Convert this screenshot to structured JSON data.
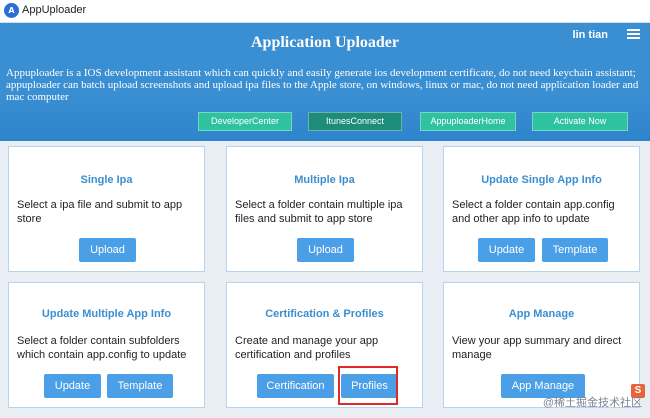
{
  "window": {
    "title": "AppUploader",
    "icon": "app-logo-icon"
  },
  "header": {
    "user": "lin tian",
    "title": "Application Uploader",
    "description": "Appuploader is a IOS development assistant which can quickly and easily generate ios development certificate, do not need keychain assistant; appuploader can batch upload screenshots and upload ipa files to the Apple store, on windows, linux or mac, do not need application loader and mac computer",
    "links": [
      "DeveloperCenter",
      "ItunesConnect",
      "AppuploaderHome",
      "Activate Now"
    ]
  },
  "cards": [
    {
      "title": "Single Ipa",
      "desc": "Select a ipa file and submit to app store",
      "buttons": [
        "Upload"
      ]
    },
    {
      "title": "Multiple Ipa",
      "desc": "Select a folder contain multiple ipa files and submit to app store",
      "buttons": [
        "Upload"
      ]
    },
    {
      "title": "Update Single App Info",
      "desc": "Select a folder contain app.config and other app info to update",
      "buttons": [
        "Update",
        "Template"
      ]
    },
    {
      "title": "Update Multiple App Info",
      "desc": "Select a folder contain subfolders which contain app.config to update",
      "buttons": [
        "Update",
        "Template"
      ]
    },
    {
      "title": "Certification & Profiles",
      "desc": "Create and manage your app certification and profiles",
      "buttons": [
        "Certification",
        "Profiles"
      ]
    },
    {
      "title": "App Manage",
      "desc": "View your app summary and direct manage",
      "buttons": [
        "App Manage"
      ]
    }
  ],
  "watermark": "@稀土掘金技术社区",
  "colors": {
    "header": "#3a8ed2",
    "accent": "#3b8fd1",
    "button": "#4a9fe6",
    "highlight": "#e02a2a"
  }
}
